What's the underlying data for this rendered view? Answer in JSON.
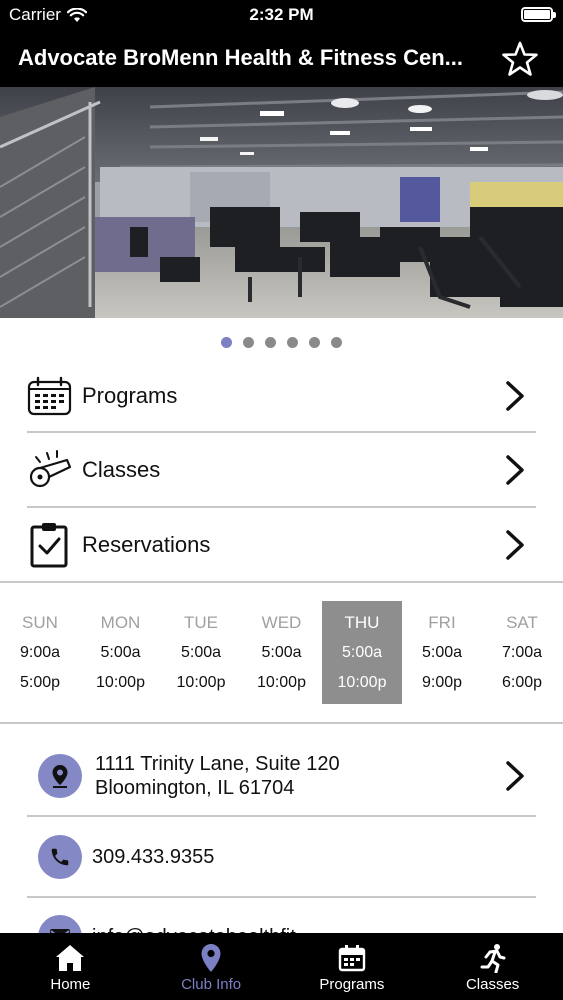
{
  "status_bar": {
    "carrier": "Carrier",
    "time": "2:32 PM"
  },
  "header": {
    "title": "Advocate BroMenn Health & Fitness Cen..."
  },
  "carousel": {
    "page_count": 6,
    "active_index": 0
  },
  "menu": [
    {
      "label": "Programs",
      "icon": "calendar-icon"
    },
    {
      "label": "Classes",
      "icon": "whistle-icon"
    },
    {
      "label": "Reservations",
      "icon": "clipboard-check-icon"
    }
  ],
  "hours": {
    "today_index": 4,
    "days": [
      {
        "name": "SUN",
        "open": "9:00a",
        "close": "5:00p"
      },
      {
        "name": "MON",
        "open": "5:00a",
        "close": "10:00p"
      },
      {
        "name": "TUE",
        "open": "5:00a",
        "close": "10:00p"
      },
      {
        "name": "WED",
        "open": "5:00a",
        "close": "10:00p"
      },
      {
        "name": "THU",
        "open": "5:00a",
        "close": "10:00p"
      },
      {
        "name": "FRI",
        "open": "5:00a",
        "close": "9:00p"
      },
      {
        "name": "SAT",
        "open": "7:00a",
        "close": "6:00p"
      }
    ]
  },
  "contact": {
    "address_line1": "1111 Trinity Lane, Suite 120",
    "address_line2": "Bloomington, IL 61704",
    "phone": "309.433.9355",
    "email_partial": "info@advocatehealthfit..."
  },
  "tabs": [
    {
      "label": "Home",
      "icon": "home-icon"
    },
    {
      "label": "Club Info",
      "icon": "map-pin-icon"
    },
    {
      "label": "Programs",
      "icon": "calendar-icon"
    },
    {
      "label": "Classes",
      "icon": "runner-icon"
    }
  ],
  "active_tab": 1,
  "colors": {
    "accent": "#7b7fc3",
    "icon_circle": "#8489c6",
    "today_bg": "#8e8e8e",
    "bar_bg": "#000000"
  }
}
